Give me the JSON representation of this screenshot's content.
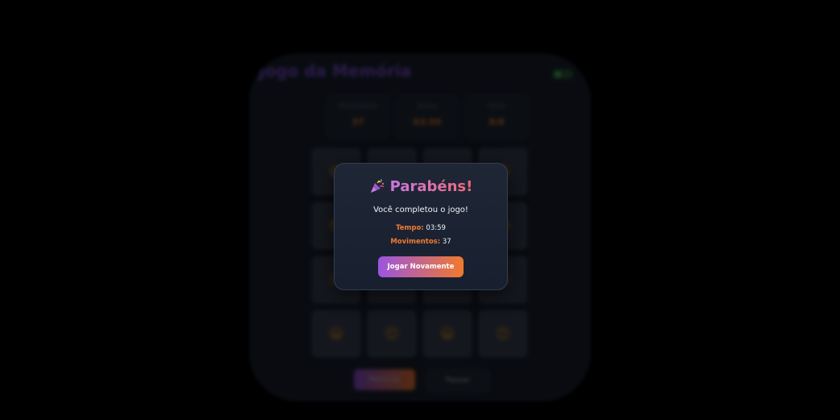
{
  "game": {
    "title": "Jogo da Memória",
    "stats": [
      {
        "label": "Movimentos",
        "value": "37"
      },
      {
        "label": "Tempo",
        "value": "03:59"
      },
      {
        "label": "Pares",
        "value": "8/8"
      }
    ],
    "cards": [
      "😄",
      "😍",
      "😎",
      "😍",
      "😎",
      "😄",
      "😂",
      "😂",
      "😜",
      "😘",
      "😘",
      "😜",
      "😀",
      "😍",
      "😀",
      "😍"
    ],
    "controls": {
      "primary_label": "Reiniciar",
      "secondary_label": "Pausar"
    }
  },
  "modal": {
    "icon": "party-popper-icon",
    "title": "Parabéns!",
    "message": "Você completou o jogo!",
    "time_label": "Tempo:",
    "time_value": "03:59",
    "moves_label": "Movimentos:",
    "moves_value": "37",
    "button_label": "Jogar Novamente"
  },
  "colors": {
    "accent_orange": "#f07b32",
    "accent_purple": "#9a55e0",
    "title_pink": "#e56f95",
    "modal_bg": "#1c2333"
  }
}
